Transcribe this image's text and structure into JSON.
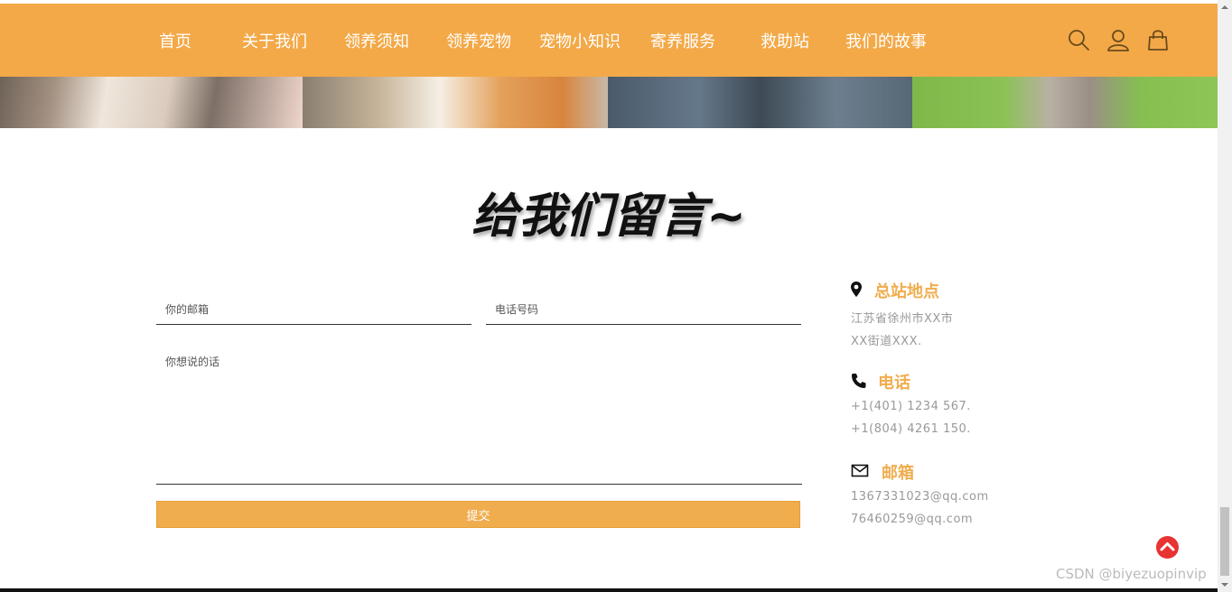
{
  "nav": {
    "items": [
      {
        "label": "首页"
      },
      {
        "label": "关于我们"
      },
      {
        "label": "领养须知"
      },
      {
        "label": "领养宠物"
      },
      {
        "label": "宠物小知识"
      },
      {
        "label": "寄养服务"
      },
      {
        "label": "救助站"
      },
      {
        "label": "我们的故事"
      }
    ],
    "icons": [
      "search-icon",
      "user-icon",
      "cart-icon"
    ]
  },
  "colors": {
    "nav_bg": "#f3a948",
    "accent": "#f0ad4e",
    "back_top": "#e83333"
  },
  "heading": "给我们留言~",
  "form": {
    "email_placeholder": "你的邮箱",
    "phone_placeholder": "电话号码",
    "message_placeholder": "你想说的话",
    "submit_label": "提交"
  },
  "contact": {
    "address": {
      "icon": "map-pin-icon",
      "title": "总站地点",
      "lines": [
        "江苏省徐州市XX市",
        "XX街道XXX."
      ]
    },
    "phone": {
      "icon": "phone-icon",
      "title": "电话",
      "lines": [
        "+1(401) 1234 567.",
        "+1(804) 4261 150."
      ]
    },
    "email": {
      "icon": "envelope-icon",
      "title": "邮箱",
      "lines": [
        "1367331023@qq.com",
        "76460259@qq.com"
      ]
    }
  },
  "watermark": "CSDN @biyezuopinvip"
}
